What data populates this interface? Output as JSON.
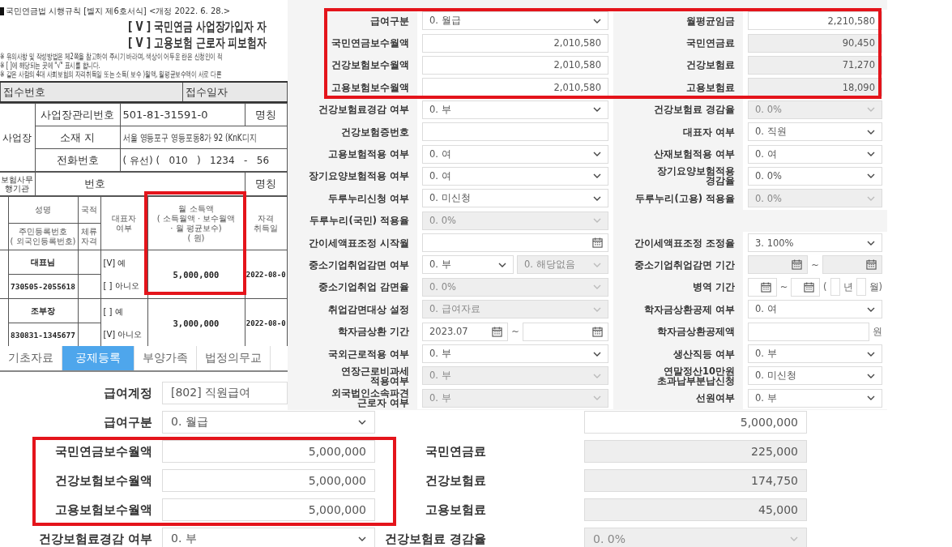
{
  "document": {
    "form_ref": "국민연금법 시행규칙 [별지 제6호서식] <개정 2022. 6. 28.>",
    "titles": [
      "[ V ] 국민연금 사업장가입자 자",
      "[ V ] 고용보험 근로자 피보험자"
    ],
    "notes": [
      "※ 유의사항 및 작성방법은 제2쪽을 참고하여 주시기 바라며, 색상이 어두운 란은 신청인이 적",
      "※ [ ]에 해당되는 곳에 \"√\" 표시를 합니다.",
      "※ 같은 사람의 4대 사회보험의 자격취득일 또는 소득( 보수 )월액, 월평균보수액이 서로 다른"
    ],
    "receipt": [
      "접수번호",
      "접수일자"
    ],
    "workplace": {
      "section": "사업장",
      "rows": [
        {
          "label": "사업장관리번호",
          "value": "501-81-31591-0",
          "extra": "명칭"
        },
        {
          "label": "소재 지",
          "value": "서울 영등포구 영등포동8가 92 (KnK디지"
        },
        {
          "label": "전화번호",
          "value": "( 유선) (   010   )   1234   -   56"
        }
      ]
    },
    "agency": {
      "section": "보험사무\n행기관",
      "label": "번호",
      "extra": "명칭"
    },
    "people_header": {
      "name": "성명",
      "id": "주민등록번호\n( 외국인등록번호)",
      "nationality": "국적",
      "residence": "체류\n자격",
      "representative": "대표자\n여부",
      "income": "월 소득액\n( 소득월액 · 보수월액\n· 월 평균보수)\n( 원)",
      "acquired": "자격\n취득일"
    },
    "people": [
      {
        "name": "대표님",
        "id": "730505-2055618",
        "rep_yes": "[V] 예",
        "rep_no": "[ ] 아니오",
        "income": "5,000,000",
        "acquired": "2022-08-0"
      },
      {
        "name": "조부장",
        "id": "830831-1345677",
        "rep_yes": "[ ] 예",
        "rep_no": "[V] 아니오",
        "income": "3,000,000",
        "acquired": "2022-08-0"
      }
    ]
  },
  "payroll": {
    "tabs": [
      {
        "label": "기초자료",
        "selected": false
      },
      {
        "label": "공제등록",
        "selected": true
      },
      {
        "label": "부양가족",
        "selected": false
      },
      {
        "label": "법정의무교",
        "selected": false
      }
    ],
    "left": [
      {
        "label": "급여계정",
        "field": {
          "kind": "text",
          "value": "[802] 직원급여"
        }
      },
      {
        "label": "급여구분",
        "field": {
          "kind": "select",
          "value": "0. 월급",
          "disabled": false
        }
      },
      {
        "label": "국민연금보수월액",
        "field": {
          "kind": "input",
          "value": "5,000,000"
        }
      },
      {
        "label": "건강보험보수월액",
        "field": {
          "kind": "input",
          "value": "5,000,000"
        }
      },
      {
        "label": "고용보험보수월액",
        "field": {
          "kind": "input",
          "value": "5,000,000"
        }
      },
      {
        "label": "건강보험료경감 여부",
        "field": {
          "kind": "select",
          "value": "0. 부",
          "disabled": false
        }
      }
    ],
    "right": [
      {
        "field": {
          "kind": "input",
          "value": "5,000,000"
        }
      },
      {
        "label": "국민연금료",
        "field": {
          "kind": "readonly",
          "value": "225,000"
        }
      },
      {
        "label": "건강보험료",
        "field": {
          "kind": "readonly",
          "value": "174,750"
        }
      },
      {
        "label": "고용보험료",
        "field": {
          "kind": "readonly",
          "value": "45,000"
        }
      },
      {
        "label": "건강보험료 경감율",
        "field": {
          "kind": "select",
          "value": "0. 0%",
          "disabled": true
        }
      }
    ]
  },
  "form": {
    "rows": [
      {
        "left": {
          "label": "급여구분",
          "fields": [
            {
              "kind": "select",
              "value": "0. 월급",
              "disabled": false
            }
          ]
        },
        "right": {
          "label": "월평균임금",
          "fields": [
            {
              "kind": "input",
              "value": "2,210,580"
            }
          ]
        }
      },
      {
        "left": {
          "label": "국민연금보수월액",
          "fields": [
            {
              "kind": "input",
              "value": "2,010,580"
            }
          ]
        },
        "right": {
          "label": "국민연금료",
          "fields": [
            {
              "kind": "readonly",
              "value": "90,450"
            }
          ]
        }
      },
      {
        "left": {
          "label": "건강보험보수월액",
          "fields": [
            {
              "kind": "input",
              "value": "2,010,580"
            }
          ]
        },
        "right": {
          "label": "건강보험료",
          "fields": [
            {
              "kind": "readonly",
              "value": "71,270"
            }
          ]
        }
      },
      {
        "left": {
          "label": "고용보험보수월액",
          "fields": [
            {
              "kind": "input",
              "value": "2,010,580"
            }
          ]
        },
        "right": {
          "label": "고용보험료",
          "fields": [
            {
              "kind": "readonly",
              "value": "18,090"
            }
          ]
        }
      },
      {
        "left": {
          "label": "건강보험료경감 여부",
          "fields": [
            {
              "kind": "select",
              "value": "0. 부",
              "disabled": false
            }
          ]
        },
        "right": {
          "label": "건강보험료 경감율",
          "fields": [
            {
              "kind": "select",
              "value": "0. 0%",
              "disabled": true
            }
          ]
        }
      },
      {
        "left": {
          "label": "건강보험증번호",
          "fields": [
            {
              "kind": "input"
            }
          ]
        },
        "right": {
          "label": "대표자 여부",
          "fields": [
            {
              "kind": "select",
              "value": "0. 직원",
              "disabled": false
            }
          ]
        }
      },
      {
        "left": {
          "label": "고용보험적용 여부",
          "fields": [
            {
              "kind": "select",
              "value": "0. 여",
              "disabled": false
            }
          ]
        },
        "right": {
          "label": "산재보험적용 여부",
          "fields": [
            {
              "kind": "select",
              "value": "0. 여",
              "disabled": false
            }
          ]
        }
      },
      {
        "left": {
          "label": "장기요양보험적용 여부",
          "fields": [
            {
              "kind": "select",
              "value": "0. 여",
              "disabled": false
            }
          ]
        },
        "right": {
          "label": "장기요양보험적용\n경감율",
          "fields": [
            {
              "kind": "select",
              "value": "0. 0%",
              "disabled": false
            }
          ]
        }
      },
      {
        "left": {
          "label": "두루누리신청 여부",
          "fields": [
            {
              "kind": "select",
              "value": "0. 미신청",
              "disabled": false
            }
          ]
        },
        "right": {
          "label": "두루누리(고용) 적용율",
          "fields": [
            {
              "kind": "select",
              "value": "0. 0%",
              "disabled": true
            }
          ]
        }
      },
      {
        "left": {
          "label": "두루누리(국민) 적용율",
          "fields": [
            {
              "kind": "select",
              "value": "0. 0%",
              "disabled": true
            }
          ]
        }
      },
      {
        "left": {
          "label": "간이세액표조정 시작월",
          "fields": [
            {
              "kind": "date",
              "disabled": false
            }
          ]
        },
        "right": {
          "label": "간이세액표조정 조정율",
          "fields": [
            {
              "kind": "select",
              "value": "3. 100%",
              "disabled": false
            }
          ]
        }
      },
      {
        "left": {
          "label": "중소기업취업감면 여부",
          "fields": [
            {
              "kind": "select",
              "value": "0. 부",
              "disabled": false
            },
            {
              "kind": "select",
              "value": "0. 해당없음",
              "disabled": true
            }
          ]
        },
        "right": {
          "label": "중소기업취업감면 기간",
          "fields": [
            {
              "kind": "date",
              "disabled": true
            },
            {
              "kind": "sep",
              "value": "~"
            },
            {
              "kind": "date",
              "disabled": true
            }
          ]
        }
      },
      {
        "left": {
          "label": "중소기업취업 감면율",
          "fields": [
            {
              "kind": "select",
              "value": "0. 0%",
              "disabled": true
            }
          ]
        },
        "right": {
          "label": "병역 기간",
          "fields": [
            {
              "kind": "date",
              "disabled": false
            },
            {
              "kind": "sep",
              "value": "~"
            },
            {
              "kind": "date",
              "disabled": false
            },
            {
              "kind": "sep",
              "value": "("
            },
            {
              "kind": "mini"
            },
            {
              "kind": "sep",
              "value": "년"
            },
            {
              "kind": "mini"
            },
            {
              "kind": "sep",
              "value": "월)"
            }
          ]
        }
      },
      {
        "left": {
          "label": "취업감면대상 설정",
          "fields": [
            {
              "kind": "select",
              "value": "0. 급여자료",
              "disabled": true
            }
          ]
        },
        "right": {
          "label": "학자금상환공제 여부",
          "fields": [
            {
              "kind": "select",
              "value": "0. 여",
              "disabled": false
            }
          ]
        }
      },
      {
        "left": {
          "label": "학자금상환 기간",
          "fields": [
            {
              "kind": "date",
              "value": "2023.07",
              "disabled": false
            },
            {
              "kind": "sep",
              "value": "~"
            },
            {
              "kind": "date",
              "disabled": false
            }
          ]
        },
        "right": {
          "label": "학자금상환공제액",
          "fields": [
            {
              "kind": "input"
            },
            {
              "kind": "sep",
              "value": "원"
            }
          ]
        }
      },
      {
        "left": {
          "label": "국외근로적용 여부",
          "fields": [
            {
              "kind": "select",
              "value": "0. 부",
              "disabled": false
            }
          ]
        },
        "right": {
          "label": "생산직등 여부",
          "fields": [
            {
              "kind": "select",
              "value": "0. 부",
              "disabled": false
            }
          ]
        }
      },
      {
        "left": {
          "label": "연장근로비과세\n적용여부",
          "fields": [
            {
              "kind": "select",
              "value": "0. 부",
              "disabled": true
            }
          ]
        },
        "right": {
          "label": "연말정산10만원\n초과납부분납신청",
          "fields": [
            {
              "kind": "select",
              "value": "0. 미신청",
              "disabled": false
            }
          ]
        }
      },
      {
        "left": {
          "label": "외국법인소속파견\n근로자 여부",
          "fields": [
            {
              "kind": "select",
              "value": "0. 부",
              "disabled": true
            }
          ]
        },
        "right": {
          "label": "선원여부",
          "fields": [
            {
              "kind": "select",
              "value": "0. 부",
              "disabled": false
            }
          ]
        }
      }
    ]
  }
}
